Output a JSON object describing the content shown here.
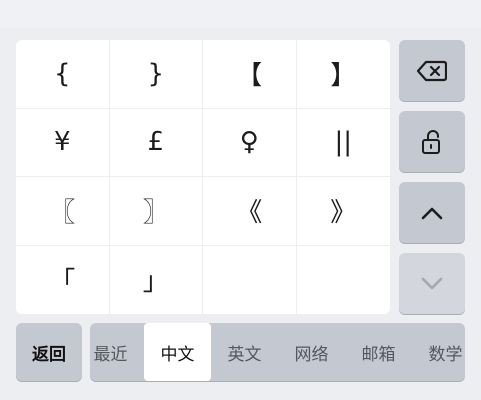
{
  "symbols": [
    "{",
    "}",
    "【",
    "】",
    "¥",
    "£",
    "♀",
    "||",
    "〖",
    "〗",
    "《",
    "》",
    "「",
    "」",
    "",
    ""
  ],
  "side_keys": {
    "delete": "delete-icon",
    "lock": "unlock-icon",
    "up": "chevron-up-icon",
    "down": "chevron-down-icon"
  },
  "bottom": {
    "back_label": "返回",
    "categories": [
      "最近",
      "中文",
      "英文",
      "网络",
      "邮箱",
      "数学"
    ],
    "active_category": "中文"
  }
}
